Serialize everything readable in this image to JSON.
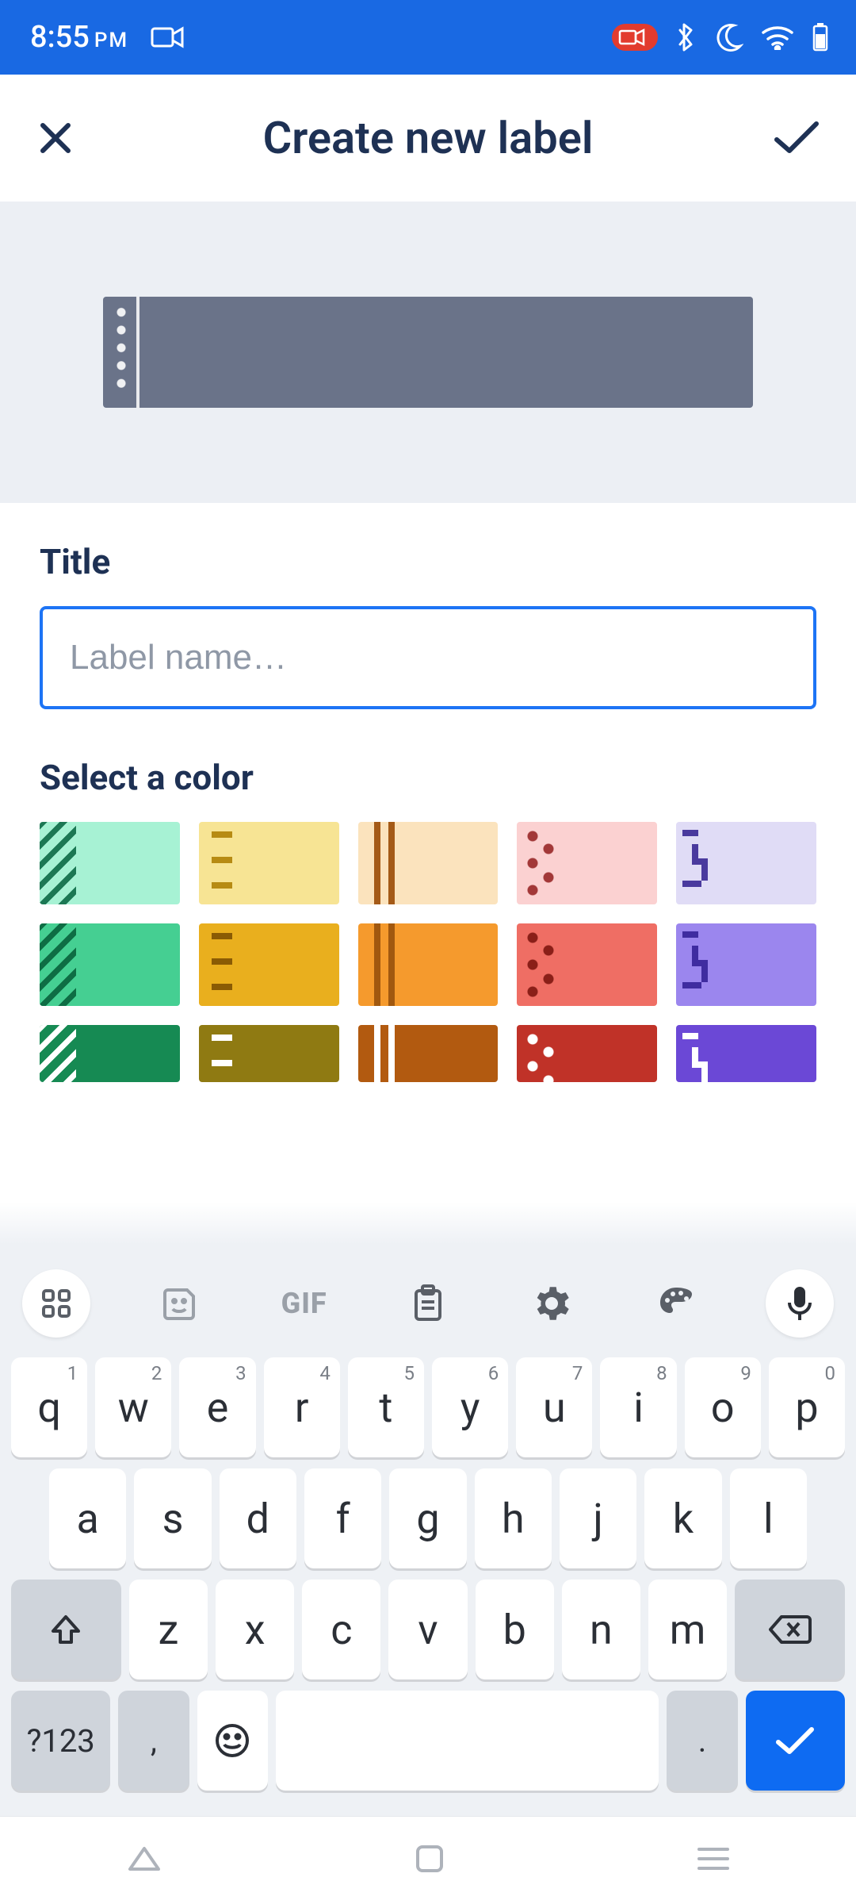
{
  "status": {
    "time": "8:55",
    "ampm": "PM"
  },
  "header": {
    "title": "Create new label"
  },
  "form": {
    "title_label": "Title",
    "title_placeholder": "Label name…",
    "title_value": "",
    "color_label": "Select a color"
  },
  "colors": {
    "rows": [
      [
        {
          "bg": "#a7f2d4",
          "ov": "#1c7854",
          "pat": "diag"
        },
        {
          "bg": "#f7e494",
          "ov": "#b78b13",
          "pat": "sq"
        },
        {
          "bg": "#fbe3bd",
          "ov": "#a45a17",
          "pat": "bars"
        },
        {
          "bg": "#fbd1d1",
          "ov": "#a23838",
          "pat": "dots"
        },
        {
          "bg": "#e0dcf6",
          "ov": "#4a3a9e",
          "pat": "step"
        }
      ],
      [
        {
          "bg": "#45cf92",
          "ov": "#0e6d44",
          "pat": "diag"
        },
        {
          "bg": "#e9af1e",
          "ov": "#8a5b04",
          "pat": "sq"
        },
        {
          "bg": "#f59a2d",
          "ov": "#a1580f",
          "pat": "bars"
        },
        {
          "bg": "#ef6e64",
          "ov": "#8a1f18",
          "pat": "dots"
        },
        {
          "bg": "#9b86ee",
          "ov": "#3f2ca0",
          "pat": "step"
        }
      ],
      [
        {
          "bg": "#168a53",
          "ov": "#ffffff",
          "pat": "diag"
        },
        {
          "bg": "#8f7a12",
          "ov": "#ffffff",
          "pat": "sq"
        },
        {
          "bg": "#b25a10",
          "ov": "#ffffff",
          "pat": "bars"
        },
        {
          "bg": "#c03228",
          "ov": "#ffffff",
          "pat": "dots"
        },
        {
          "bg": "#6b48d6",
          "ov": "#ffffff",
          "pat": "step"
        }
      ]
    ]
  },
  "keyboard": {
    "gif_label": "GIF",
    "row1": [
      {
        "k": "q",
        "s": "1"
      },
      {
        "k": "w",
        "s": "2"
      },
      {
        "k": "e",
        "s": "3"
      },
      {
        "k": "r",
        "s": "4"
      },
      {
        "k": "t",
        "s": "5"
      },
      {
        "k": "y",
        "s": "6"
      },
      {
        "k": "u",
        "s": "7"
      },
      {
        "k": "i",
        "s": "8"
      },
      {
        "k": "o",
        "s": "9"
      },
      {
        "k": "p",
        "s": "0"
      }
    ],
    "row2": [
      "a",
      "s",
      "d",
      "f",
      "g",
      "h",
      "j",
      "k",
      "l"
    ],
    "row3": [
      "z",
      "x",
      "c",
      "v",
      "b",
      "n",
      "m"
    ],
    "symbols_label": "?123",
    "comma": ",",
    "period": "."
  }
}
